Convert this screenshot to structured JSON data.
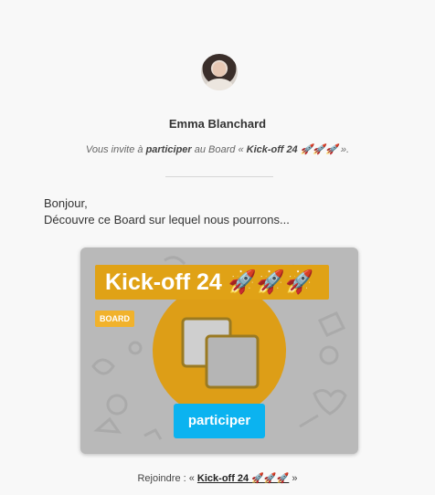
{
  "sender": {
    "name": "Emma Blanchard"
  },
  "invite": {
    "prefix": "Vous invite à ",
    "action": "participer",
    "middle": " au Board « ",
    "board": "Kick-off 24 🚀🚀🚀",
    "suffix": " »."
  },
  "message": {
    "line1": "Bonjour,",
    "line2": "Découvre ce Board sur lequel nous pourrons..."
  },
  "card": {
    "title": "Kick-off 24 🚀🚀🚀",
    "badge": "BOARD",
    "button_label": "participer",
    "accent_color": "#e0a216",
    "button_color": "#0bb3f0"
  },
  "footer": {
    "prefix": "Rejoindre : « ",
    "link": "Kick-off 24 🚀🚀🚀",
    "suffix": " »"
  }
}
